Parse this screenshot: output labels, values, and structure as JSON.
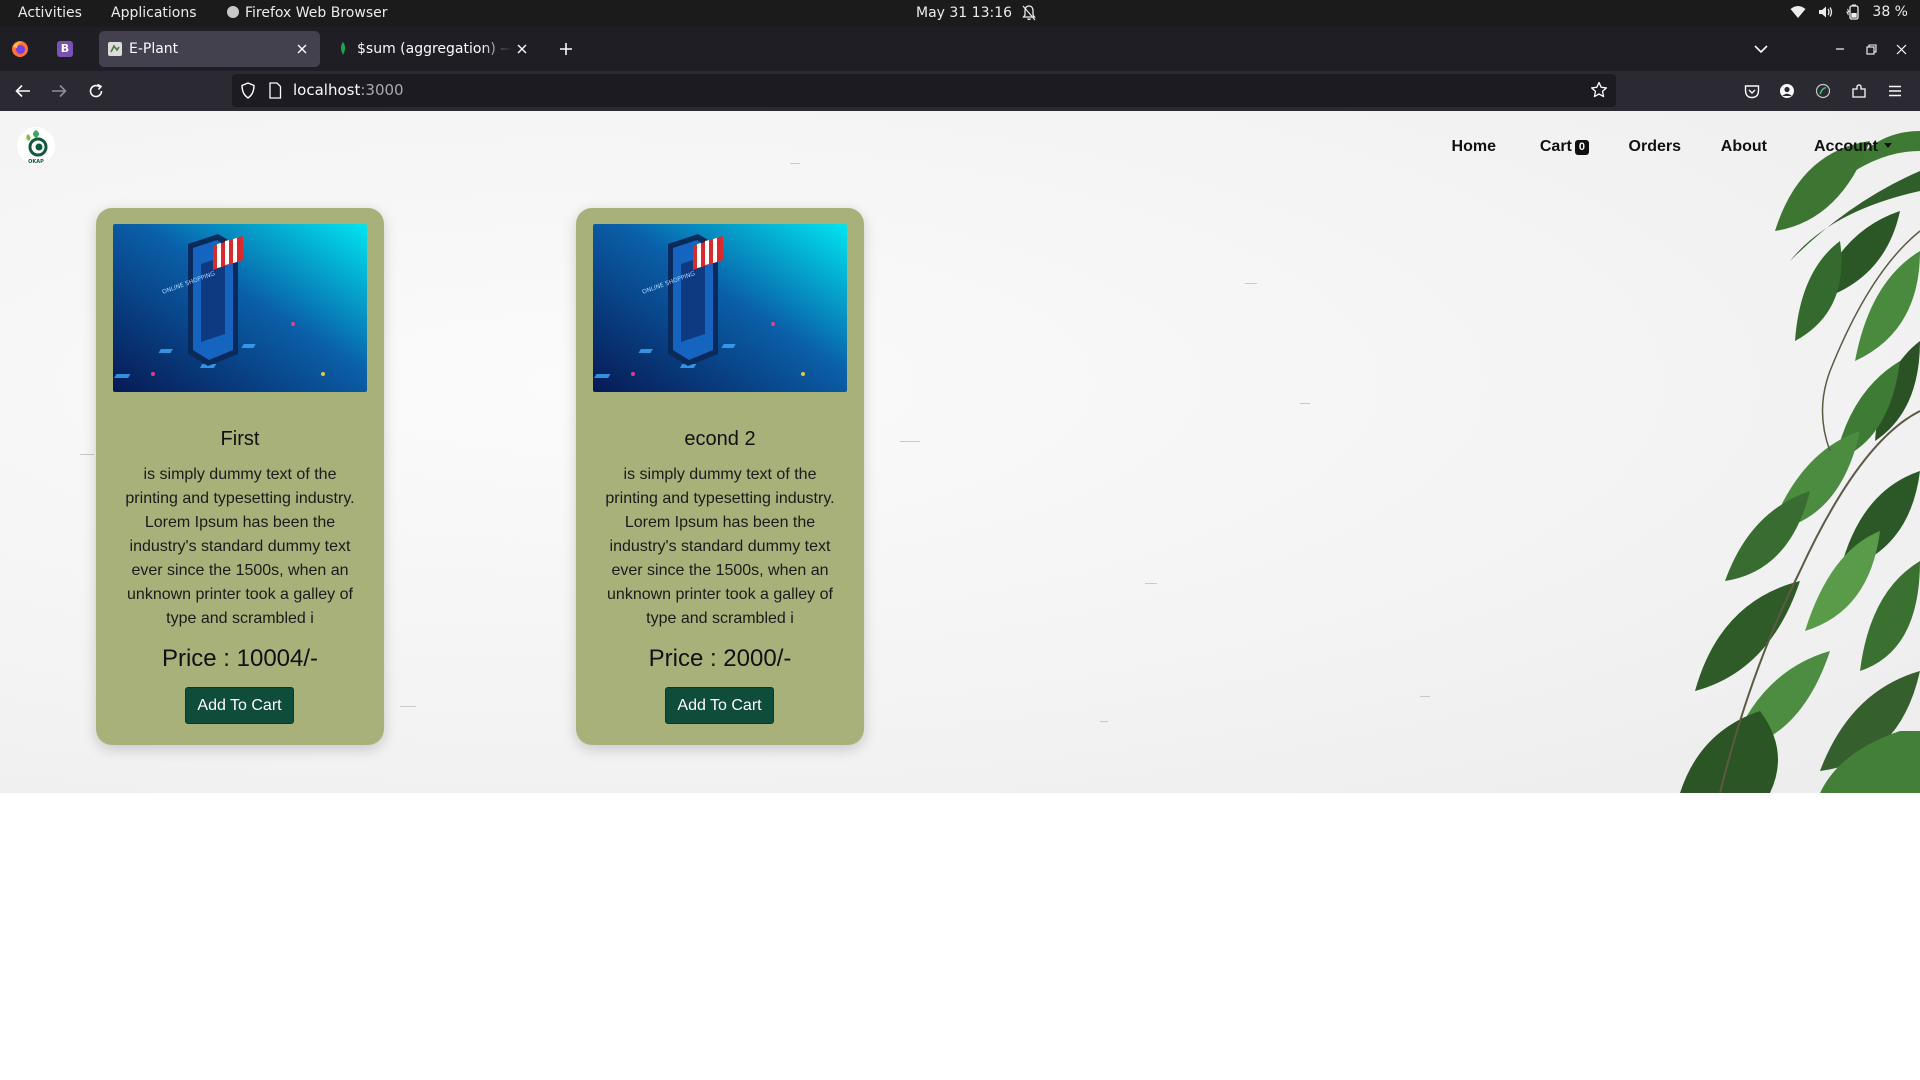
{
  "system_bar": {
    "activities": "Activities",
    "applications": "Applications",
    "app_name": "Firefox Web Browser",
    "date_time": "May 31  13:16",
    "battery": "38 %"
  },
  "browser": {
    "tabs": [
      {
        "title": "E-Plant",
        "active": true
      },
      {
        "title": "$sum (aggregation) — MongoDB Manual",
        "active": false
      }
    ],
    "url_host": "localhost",
    "url_port": ":3000"
  },
  "site": {
    "logo_text": "OKAP",
    "nav": {
      "home": "Home",
      "cart": "Cart",
      "cart_count": "0",
      "orders": "Orders",
      "about": "About",
      "account": "Account"
    },
    "products": [
      {
        "title": "First",
        "description": "is simply dummy text of the printing and typesetting industry. Lorem Ipsum has been the industry's standard dummy text ever since the 1500s, when an unknown printer took a galley of type and scrambled i",
        "price": "Price : 10004/-",
        "button": "Add To Cart",
        "image_text": "ONLINE SHOPPING"
      },
      {
        "title": "econd 2",
        "description": "is simply dummy text of the printing and typesetting industry. Lorem Ipsum has been the industry's standard dummy text ever since the 1500s, when an unknown printer took a galley of type and scrambled i",
        "price": "Price : 2000/-",
        "button": "Add To Cart",
        "image_text": "ONLINE SHOPPING"
      }
    ]
  },
  "colors": {
    "card_bg": "#a9b17a",
    "button_bg": "#0f4d3a",
    "topbar_bg": "#1b1b1b",
    "tabstrip_bg": "#1f1e25",
    "toolbar_bg": "#2b2a33"
  }
}
